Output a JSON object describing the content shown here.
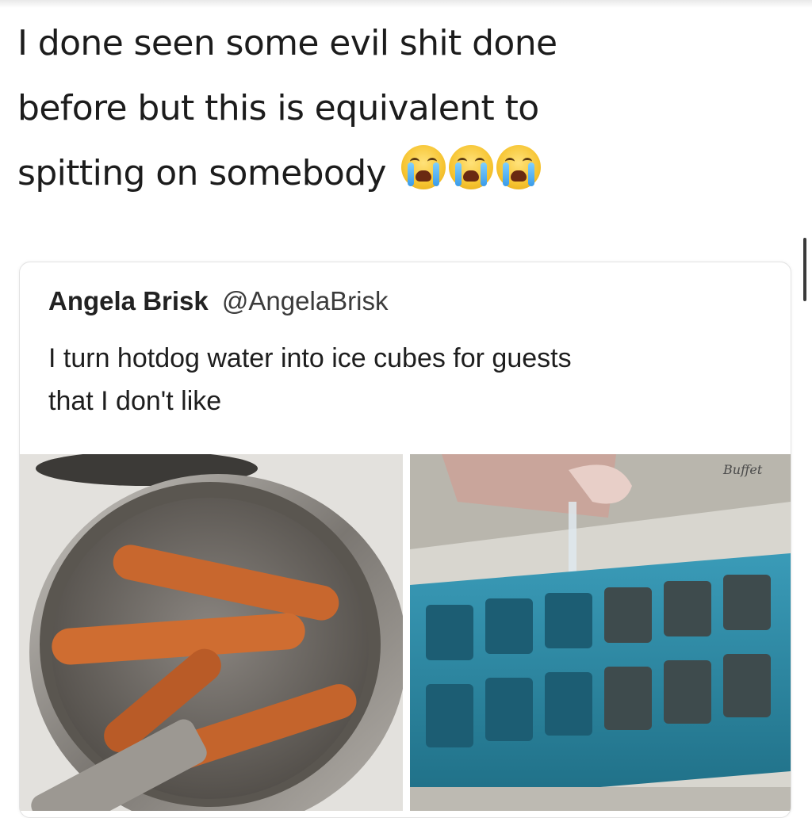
{
  "caption": {
    "line1": "I done seen some evil shit done",
    "line2": "before but this is equivalent to",
    "line3": "spitting on somebody",
    "emojis": [
      "loudly-crying-face-icon",
      "loudly-crying-face-icon",
      "loudly-crying-face-icon"
    ]
  },
  "tweet": {
    "name": "Angela Brisk",
    "handle": "@AngelaBrisk",
    "text_line1": "I turn hotdog water into ice cubes for guests",
    "text_line2": "that I don't like"
  },
  "images": {
    "left": {
      "subject": "hotdogs-boiling-in-pot"
    },
    "right": {
      "subject": "pouring-water-into-ice-tray",
      "tray_label": "Buffet"
    }
  },
  "colors": {
    "text": "#1c1c1c",
    "card_border": "#e2e2e2",
    "tray_blue": "#2d8aa6",
    "hotdog": "#c8672e"
  }
}
